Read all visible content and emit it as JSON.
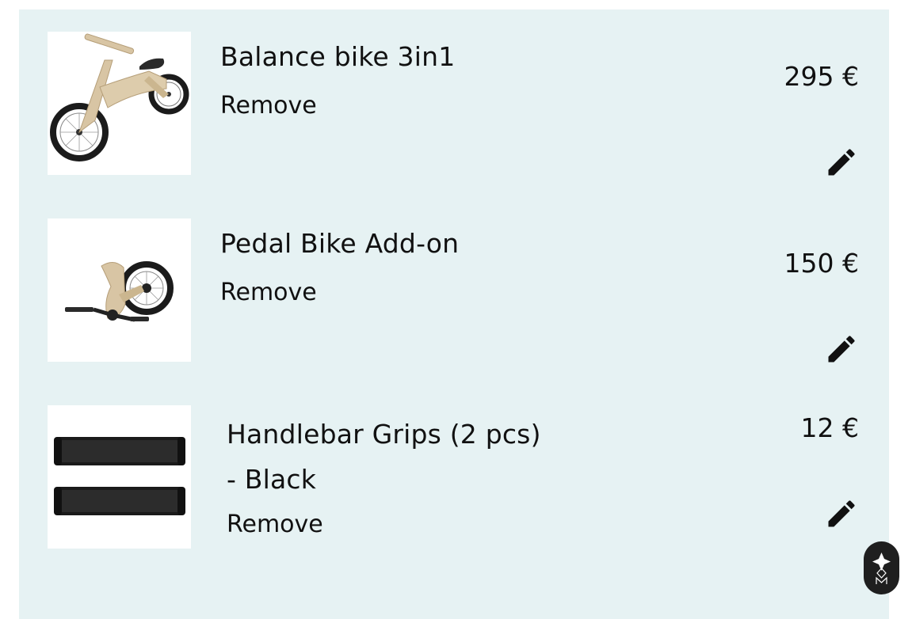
{
  "cart": {
    "items": [
      {
        "name": "Balance bike 3in1",
        "remove_label": "Remove",
        "price": "295 €",
        "edit_icon": "pencil-icon",
        "image_icon": "balance-bike-image"
      },
      {
        "name": "Pedal Bike Add-on",
        "remove_label": "Remove",
        "price": "150 €",
        "edit_icon": "pencil-icon",
        "image_icon": "pedal-addon-image"
      },
      {
        "name": "Handlebar Grips (2 pcs) - Black",
        "remove_label": "Remove",
        "price": "12 €",
        "edit_icon": "pencil-icon",
        "image_icon": "handlebar-grips-image"
      }
    ]
  },
  "colors": {
    "panel_background": "#e6f2f3",
    "text": "#111111",
    "fab_background": "#1f1f1f"
  },
  "fab": {
    "icon": "logo-mark-icon"
  }
}
